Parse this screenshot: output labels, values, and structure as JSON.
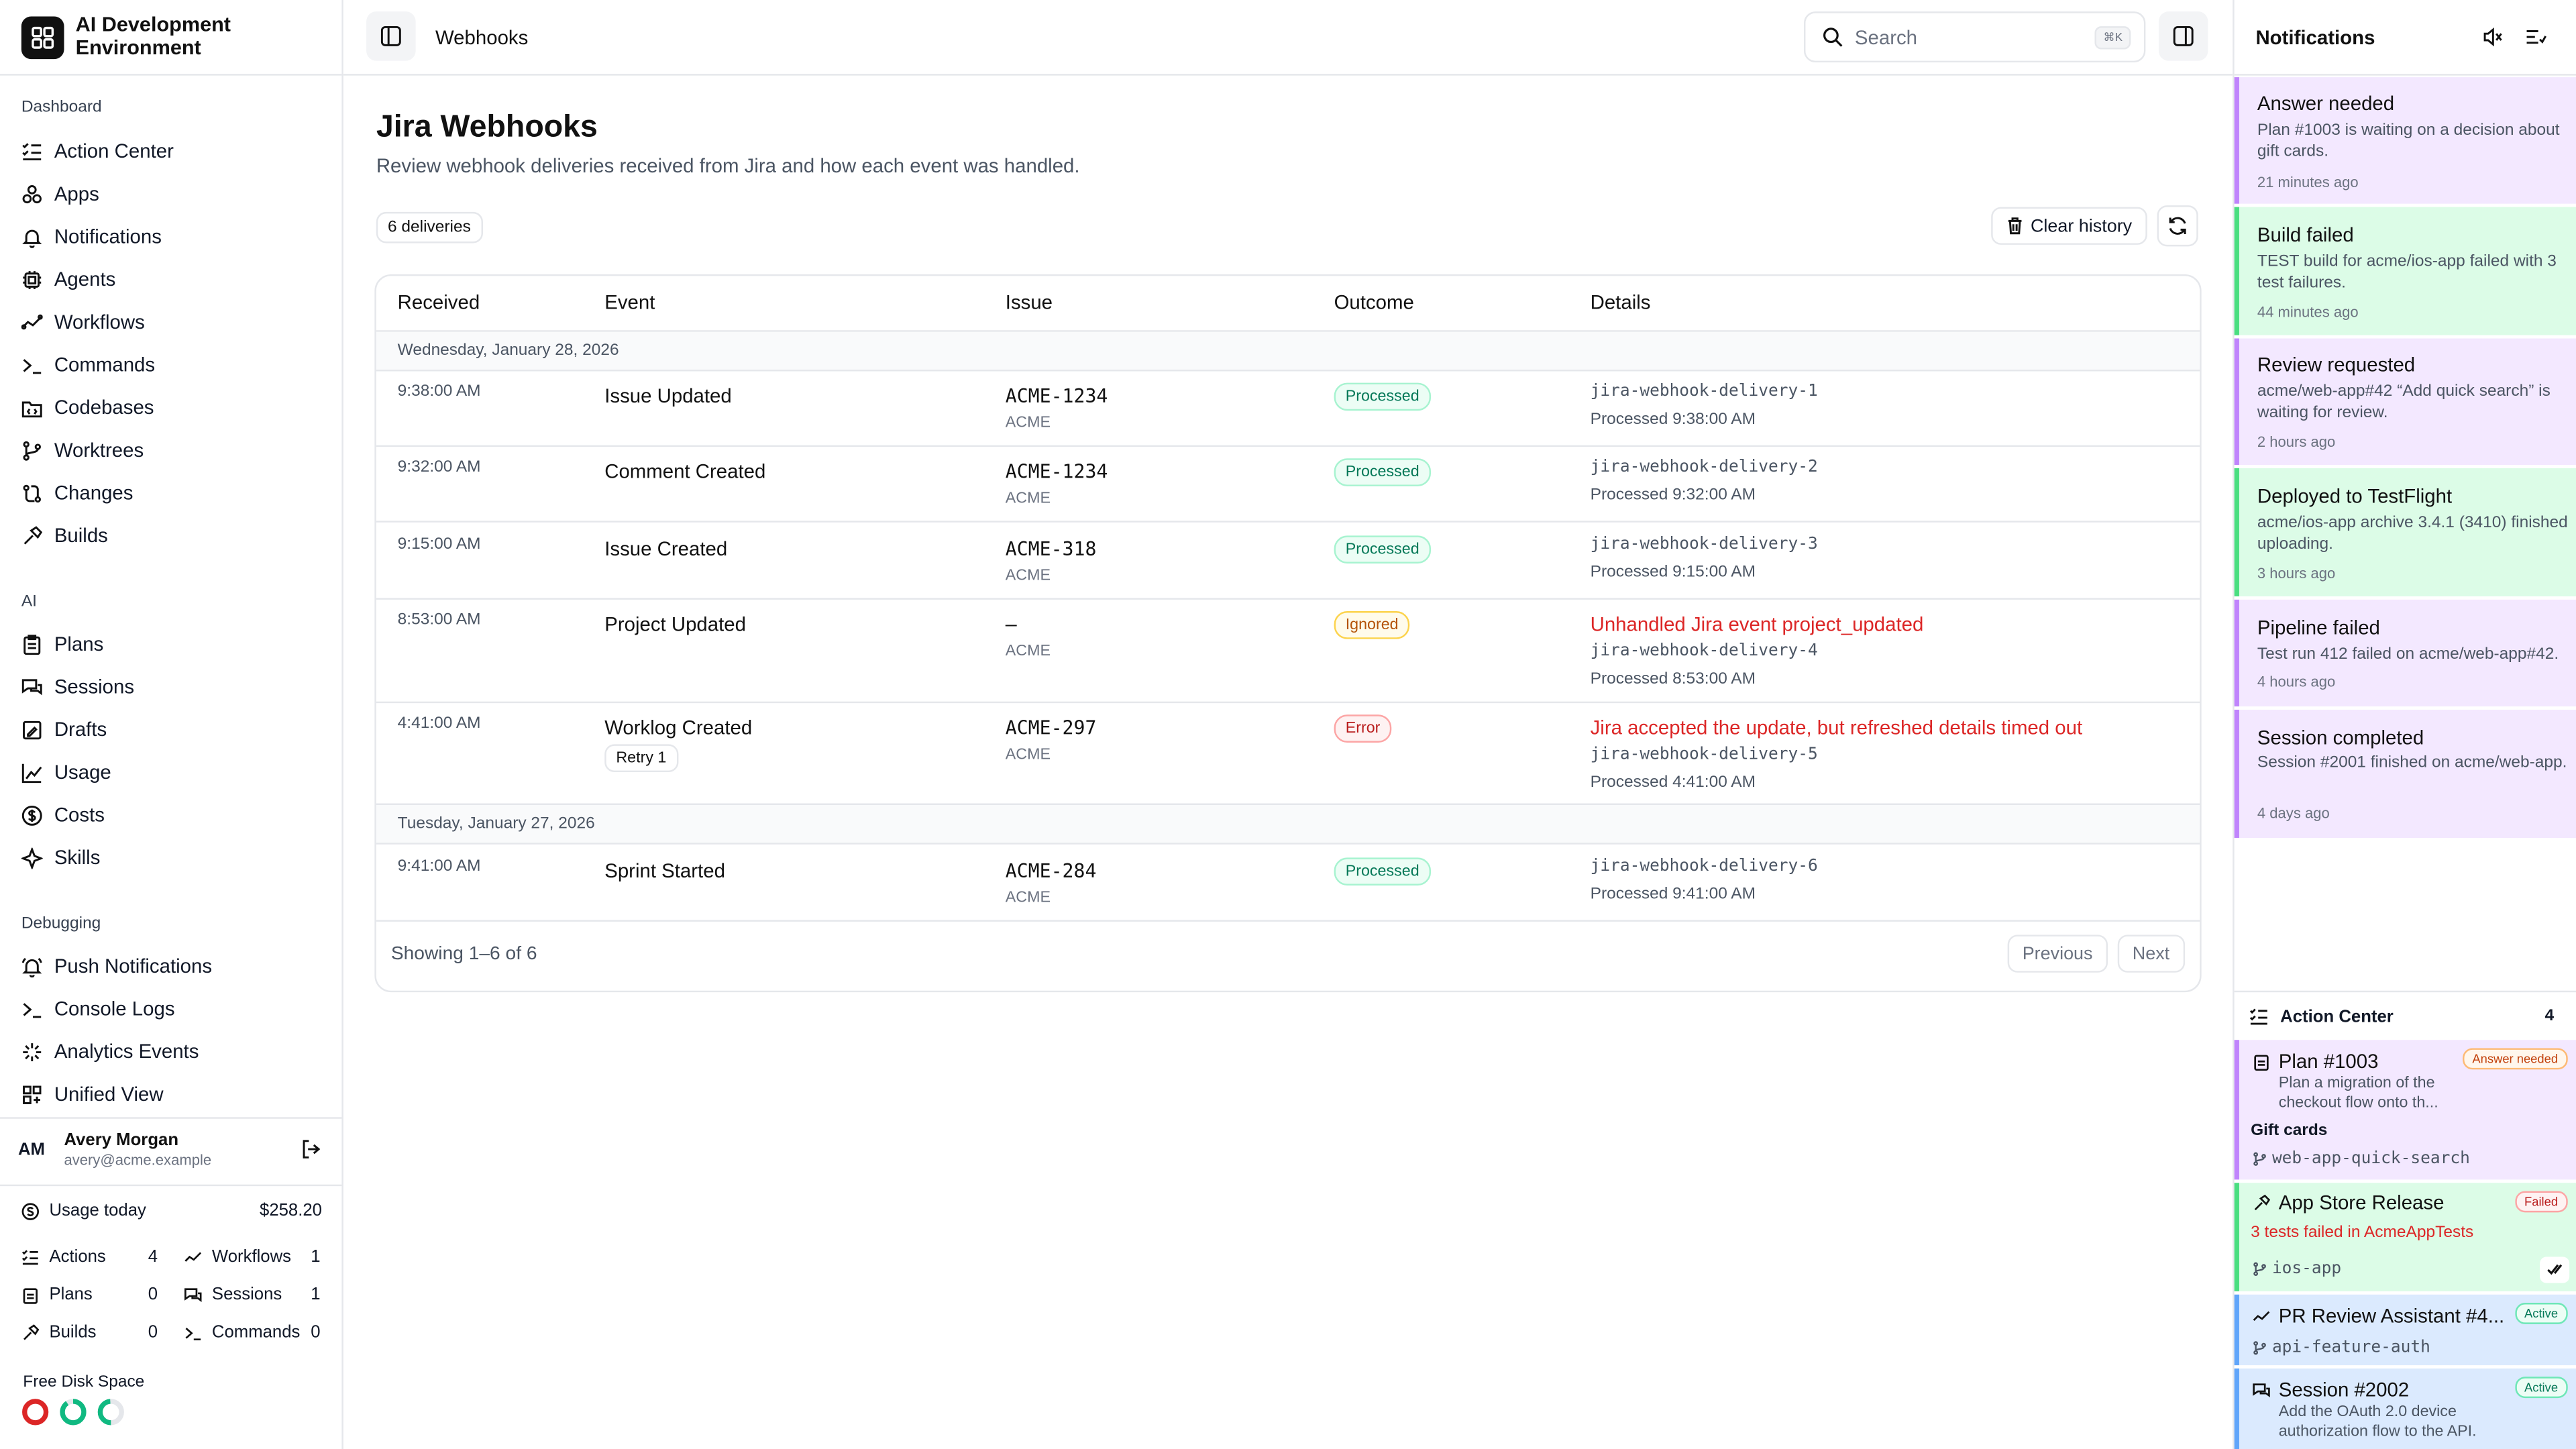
{
  "app": {
    "name_line1": "AI Development",
    "name_line2": "Environment"
  },
  "sidebar": {
    "sections": [
      {
        "label": "Dashboard",
        "items": [
          {
            "label": "Action Center",
            "icon": "list-check-icon"
          },
          {
            "label": "Apps",
            "icon": "apps-icon"
          },
          {
            "label": "Notifications",
            "icon": "bell-icon"
          },
          {
            "label": "Agents",
            "icon": "cpu-icon"
          },
          {
            "label": "Workflows",
            "icon": "workflow-icon"
          },
          {
            "label": "Commands",
            "icon": "terminal-icon"
          },
          {
            "label": "Codebases",
            "icon": "folder-code-icon"
          },
          {
            "label": "Worktrees",
            "icon": "git-branch-icon"
          },
          {
            "label": "Changes",
            "icon": "git-compare-icon"
          },
          {
            "label": "Builds",
            "icon": "hammer-icon"
          }
        ]
      },
      {
        "label": "AI",
        "items": [
          {
            "label": "Plans",
            "icon": "clipboard-icon"
          },
          {
            "label": "Sessions",
            "icon": "chat-icon"
          },
          {
            "label": "Drafts",
            "icon": "draft-icon"
          },
          {
            "label": "Usage",
            "icon": "chart-icon"
          },
          {
            "label": "Costs",
            "icon": "dollar-icon"
          },
          {
            "label": "Skills",
            "icon": "sparkle-icon"
          }
        ]
      },
      {
        "label": "Debugging",
        "items": [
          {
            "label": "Push Notifications",
            "icon": "bell-ring-icon"
          },
          {
            "label": "Console Logs",
            "icon": "terminal-icon"
          },
          {
            "label": "Analytics Events",
            "icon": "activity-icon"
          },
          {
            "label": "Unified View",
            "icon": "layout-icon"
          }
        ]
      }
    ],
    "user": {
      "initials": "AM",
      "name": "Avery Morgan",
      "email": "avery@acme.example"
    },
    "usage": {
      "label": "Usage today",
      "value": "$258.20"
    },
    "stats": [
      {
        "label": "Actions",
        "value": "4"
      },
      {
        "label": "Workflows",
        "value": "1"
      },
      {
        "label": "Plans",
        "value": "0"
      },
      {
        "label": "Sessions",
        "value": "1"
      },
      {
        "label": "Builds",
        "value": "0"
      },
      {
        "label": "Commands",
        "value": "0"
      }
    ],
    "disk_label": "Free Disk Space"
  },
  "topbar": {
    "breadcrumb": "Webhooks",
    "search_placeholder": "Search",
    "search_shortcut": "⌘K"
  },
  "page": {
    "title": "Jira Webhooks",
    "subtitle": "Review webhook deliveries received from Jira and how each event was handled.",
    "count_badge": "6 deliveries",
    "clear_button": "Clear history"
  },
  "table": {
    "columns": [
      "Received",
      "Event",
      "Issue",
      "Outcome",
      "Details"
    ],
    "groups": [
      {
        "date": "Wednesday, January 28, 2026",
        "rows": [
          {
            "time": "9:38:00 AM",
            "event": "Issue Updated",
            "issue": "ACME-1234",
            "project": "ACME",
            "outcome": "Processed",
            "error": "",
            "delivery": "jira-webhook-delivery-1",
            "processed": "Processed 9:38:00 AM",
            "retry": ""
          },
          {
            "time": "9:32:00 AM",
            "event": "Comment Created",
            "issue": "ACME-1234",
            "project": "ACME",
            "outcome": "Processed",
            "error": "",
            "delivery": "jira-webhook-delivery-2",
            "processed": "Processed 9:32:00 AM",
            "retry": ""
          },
          {
            "time": "9:15:00 AM",
            "event": "Issue Created",
            "issue": "ACME-318",
            "project": "ACME",
            "outcome": "Processed",
            "error": "",
            "delivery": "jira-webhook-delivery-3",
            "processed": "Processed 9:15:00 AM",
            "retry": ""
          },
          {
            "time": "8:53:00 AM",
            "event": "Project Updated",
            "issue": "–",
            "project": "ACME",
            "outcome": "Ignored",
            "error": "Unhandled Jira event project_updated",
            "delivery": "jira-webhook-delivery-4",
            "processed": "Processed 8:53:00 AM",
            "retry": ""
          },
          {
            "time": "4:41:00 AM",
            "event": "Worklog Created",
            "issue": "ACME-297",
            "project": "ACME",
            "outcome": "Error",
            "error": "Jira accepted the update, but refreshed details timed out",
            "delivery": "jira-webhook-delivery-5",
            "processed": "Processed 4:41:00 AM",
            "retry": "Retry 1"
          }
        ]
      },
      {
        "date": "Tuesday, January 27, 2026",
        "rows": [
          {
            "time": "9:41:00 AM",
            "event": "Sprint Started",
            "issue": "ACME-284",
            "project": "ACME",
            "outcome": "Processed",
            "error": "",
            "delivery": "jira-webhook-delivery-6",
            "processed": "Processed 9:41:00 AM",
            "retry": ""
          }
        ]
      }
    ],
    "footer": "Showing 1–6 of 6",
    "prev": "Previous",
    "next": "Next"
  },
  "notifications": {
    "title": "Notifications",
    "items": [
      {
        "title": "Answer needed",
        "body": "Plan #1003 is waiting on a decision about gift cards.",
        "time": "21 minutes ago",
        "color": "purple"
      },
      {
        "title": "Build failed",
        "body": "TEST build for acme/ios-app failed with 3 test failures.",
        "time": "44 minutes ago",
        "color": "green"
      },
      {
        "title": "Review requested",
        "body": "acme/web-app#42 “Add quick search” is waiting for review.",
        "time": "2 hours ago",
        "color": "purple"
      },
      {
        "title": "Deployed to TestFlight",
        "body": "acme/ios-app archive 3.4.1 (3410) finished uploading.",
        "time": "3 hours ago",
        "color": "green"
      },
      {
        "title": "Pipeline failed",
        "body": "Test run 412 failed on acme/web-app#42.",
        "time": "4 hours ago",
        "color": "purple"
      },
      {
        "title": "Session completed",
        "body": "Session #2001 finished on acme/web-app.",
        "time": "4 days ago",
        "color": "purple"
      }
    ]
  },
  "action_center": {
    "title": "Action Center",
    "count": "4",
    "cards": [
      {
        "title": "Plan #1003",
        "tag": "Answer needed",
        "desc": "Plan a migration of the checkout flow onto th...",
        "extra": "Gift cards",
        "branch": "web-app-quick-search"
      },
      {
        "title": "App Store Release",
        "tag": "Failed",
        "desc": "3 tests failed in AcmeAppTests",
        "branch": "ios-app"
      },
      {
        "title": "PR Review Assistant #4...",
        "tag": "Active",
        "branch": "api-feature-auth"
      },
      {
        "title": "Session #2002",
        "tag": "Active",
        "desc": "Add the OAuth 2.0 device authorization flow to the API."
      }
    ]
  },
  "colors": {
    "accent_purple": "#c084fc",
    "accent_green": "#4ade80",
    "accent_blue": "#60a5fa",
    "error": "#dc2626"
  }
}
